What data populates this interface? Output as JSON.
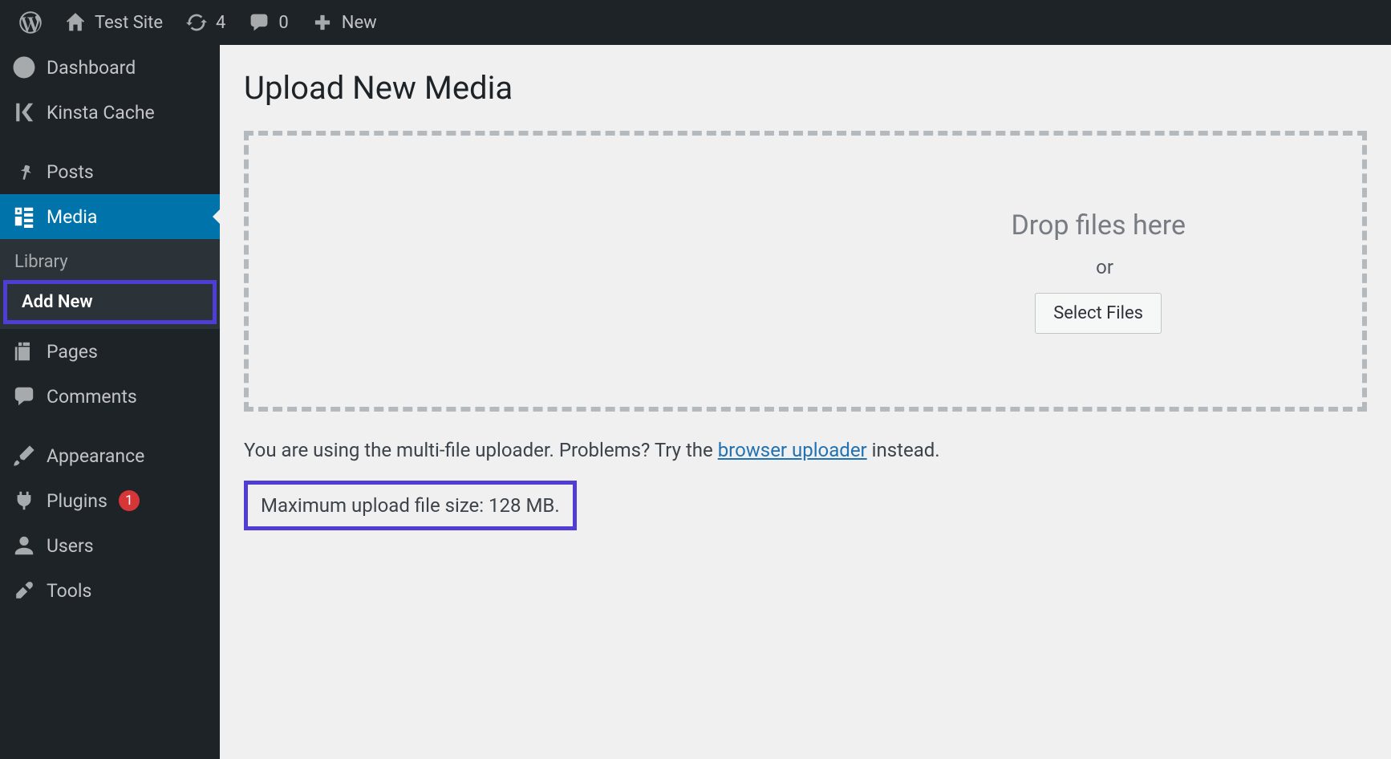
{
  "adminbar": {
    "site_name": "Test Site",
    "updates_count": "4",
    "comments_count": "0",
    "new_label": "New"
  },
  "sidebar": {
    "dashboard": "Dashboard",
    "kinsta": "Kinsta Cache",
    "posts": "Posts",
    "media": "Media",
    "media_sub": {
      "library": "Library",
      "add_new": "Add New"
    },
    "pages": "Pages",
    "comments": "Comments",
    "appearance": "Appearance",
    "plugins": "Plugins",
    "plugins_count": "1",
    "users": "Users",
    "tools": "Tools"
  },
  "main": {
    "title": "Upload New Media",
    "drop_msg": "Drop files here",
    "or": "or",
    "select_btn": "Select Files",
    "info_before": "You are using the multi-file uploader. Problems? Try the ",
    "info_link": "browser uploader",
    "info_after": " instead.",
    "max_size": "Maximum upload file size: 128 MB."
  }
}
